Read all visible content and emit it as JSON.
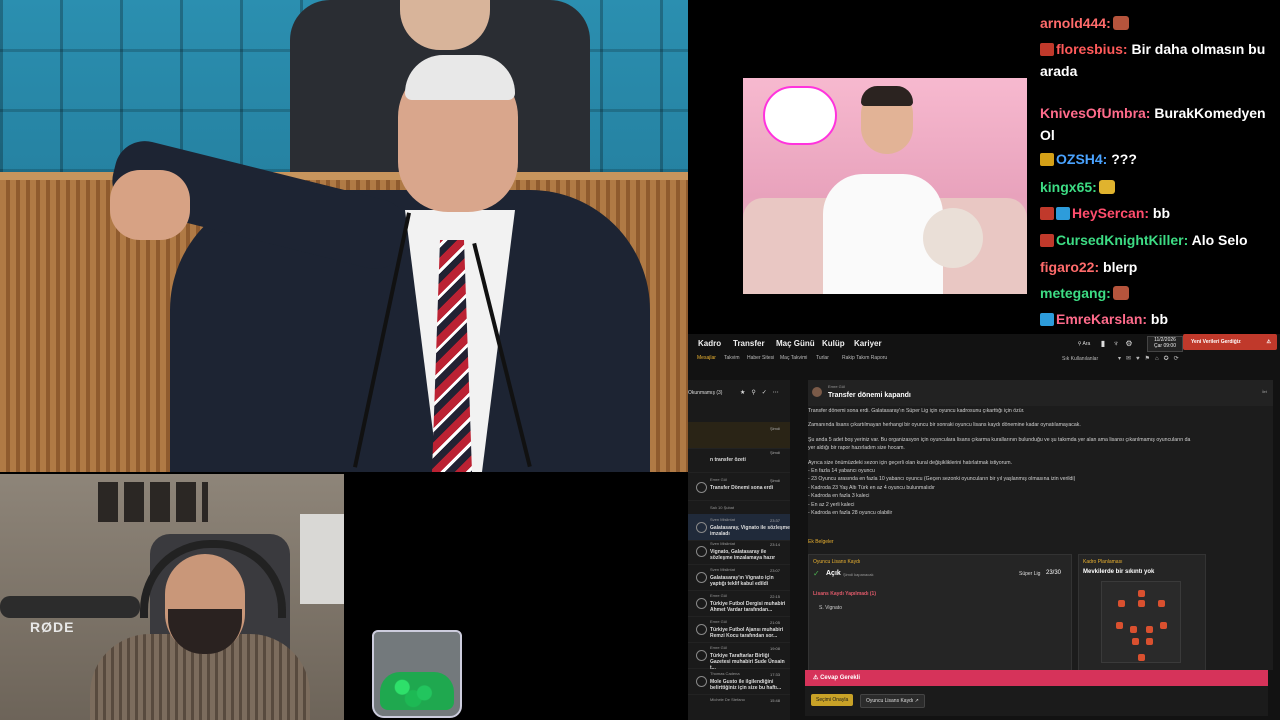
{
  "chat": {
    "messages": [
      {
        "user": "arnold444:",
        "color": "#ff6b6b",
        "text": "",
        "emote": "#b5543c"
      },
      {
        "user": "floresbius:",
        "color": "#ff5a5a",
        "text": "Bir daha olmasın bu",
        "text2": "arada",
        "badge": "#c0392b"
      },
      {
        "user": "KnivesOfUmbra:",
        "color": "#ff6b8b",
        "text": "BurakKomedyen",
        "text2": "Ol"
      },
      {
        "user": "OZSH4:",
        "color": "#4aa3ff",
        "text": "???",
        "badge": "#d4a017"
      },
      {
        "user": "kingx65:",
        "color": "#3ddc84",
        "text": "",
        "emote": "#e0b32e"
      },
      {
        "user": "HeySercan:",
        "color": "#ff4d6d",
        "text": "bb",
        "badge": "#c0392b",
        "badge2": "#2d9cdb"
      },
      {
        "user": "CursedKnightKiller:",
        "color": "#3ddc84",
        "text": "Alo Selo",
        "badge": "#c0392b"
      },
      {
        "user": "figaro22:",
        "color": "#ff6b6b",
        "text": "blerp"
      },
      {
        "user": "metegang:",
        "color": "#3ddc84",
        "text": "",
        "emote": "#b5543c"
      },
      {
        "user": "EmreKarslan:",
        "color": "#ff6b8b",
        "text": "bb",
        "badge2": "#2d9cdb"
      }
    ]
  },
  "webcam": {
    "mic_brand": "RØDE"
  },
  "game": {
    "nav": [
      "Kadro",
      "Transfer",
      "Maç Günü",
      "Kulüp",
      "Kariyer"
    ],
    "subnav": [
      "Mesajlar",
      "Takvim",
      "Haber Sitesi",
      "Maç Takvimi",
      "Turlar",
      "Rakip Takım Raporu"
    ],
    "search_label": "Ara",
    "date": "11/2/2026",
    "date_sub": "Çar 09:00",
    "continue_button": "Yeni Verileri Gerdiğiz",
    "favorites": "Sık Kullanılanlar",
    "inbox_filter": "Okunmamış (3)",
    "inbox": [
      {
        "from": "",
        "title": "",
        "time": "Şimdi"
      },
      {
        "from": "",
        "title": "n transfer özeti",
        "time": "Şimdi"
      },
      {
        "from": "Emre Gül",
        "title": "Transfer Dönemi sona erdi",
        "time": "Şimdi"
      },
      {
        "from": "Salı 10 Şubat",
        "title": "",
        "time": ""
      },
      {
        "from": "Sven Mislintat",
        "title": "Galatasaray, Vignato ile sözleşme imzaladı",
        "time": "23:37"
      },
      {
        "from": "Sven Mislintat",
        "title": "Vignato, Galatasaray ile sözleşme imzalamaya hazır",
        "time": "23:14"
      },
      {
        "from": "Sven Mislintat",
        "title": "Galatasaray'ın Vignato için yaptığı teklif kabul edildi",
        "time": "23:07"
      },
      {
        "from": "Emre Gül",
        "title": "Türkiye Futbol Dergisi muhabiri Ahmet Vardar tarafından...",
        "time": "22:15"
      },
      {
        "from": "Emre Gül",
        "title": "Türkiye Futbol Ajansı muhabiri Remzi Kocu tarafından sor...",
        "time": "21:05"
      },
      {
        "from": "Emre Gül",
        "title": "Türkiye Taraftarlar Birliği Gazetesi muhabiri Sude Ünsain t...",
        "time": "19:08"
      },
      {
        "from": "Thomas Cadena",
        "title": "Mole Gusto ile ilgilendiğini belirttiğiniz için size bu haftı...",
        "time": "17:33"
      },
      {
        "from": "Michele De Stefano",
        "title": "",
        "time": "15:48"
      }
    ],
    "message": {
      "sender": "Emre Gül",
      "subject": "Transfer dönemi kapandı",
      "forward": "İlet",
      "lines": [
        "Transfer dönemi sona erdi. Galatasaray'ın Süper Lig için oyuncu kadrosunu çıkarttığı için özür.",
        "",
        "Zamanında lisans çıkartılmayan herhangi bir oyuncu bir sonraki oyuncu lisans kaydı dönemine kadar oynatılamayacak.",
        "",
        "Şu anda 5 adet boş yeriniz var. Bu organizasyon için oyunculara lisans çıkarma kurallarının bulunduğu ve şu takımda yer alan ama lisansı çıkarılmamış oyuncuların da",
        "yer aldığı bir rapor hazırladım size hocam.",
        "",
        "Ayrıca size önümüzdeki sezon için geçerli olan kural değişikliklerini hatırlatmak istiyorum.",
        "- En fazla 14 yabancı oyuncu",
        "- 23 Oyuncu arasında en fazla 10 yabancı oyuncu (Geçen sezonki oyuncuların bir yıl yaşlanmış olmasına izin verildi)",
        "- Kadroda 23 Yaş Altı Türk en az 4 oyuncu bulunmalıdır",
        "- Kadroda en fazla 3 kaleci",
        "- En az 2 yerli kaleci",
        "- Kadroda en fazla 28 oyuncu olabilir"
      ],
      "section": "Ek Belgeler",
      "card1_title": "Oyuncu Lisans Kaydı",
      "card1_status": "Açık",
      "card1_status_sub": "Şimdi kapanacak",
      "card1_league": "Süper Lig",
      "card1_count": "23/30",
      "card1_sub": "Lisans Kaydı Yapılmadı (1)",
      "card1_player": "S. Vignato",
      "card2_title": "Kadro Planlaması",
      "card2_text": "Mevkilerde bir sıkıntı yok"
    },
    "alert": "Cevap Gerekli",
    "footer_btn1": "Seçimi Onayla",
    "footer_btn2": "Oyuncu Lisans Kaydı"
  }
}
